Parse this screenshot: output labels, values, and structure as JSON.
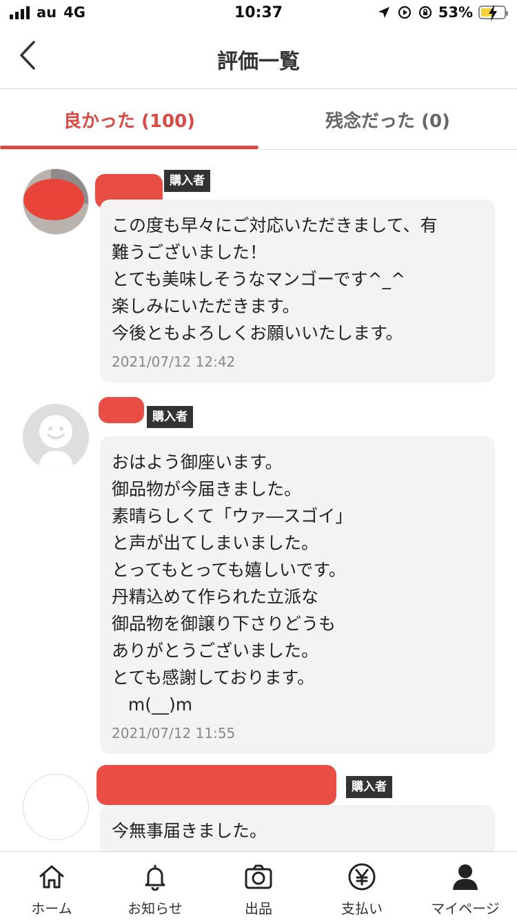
{
  "status_bar": {
    "carrier": "au",
    "network": "4G",
    "time": "10:37",
    "battery": "53%",
    "battery_level": 0.53,
    "battery_color": "#f5d33a"
  },
  "nav": {
    "back_icon": "chevron-left-icon",
    "title": "評価一覧"
  },
  "tabs": [
    {
      "label": "良かった (100)",
      "active": true
    },
    {
      "label": "残念だった (0)",
      "active": false
    }
  ],
  "accent_color": "#d94a45",
  "reviews": [
    {
      "badge": "購入者",
      "lines": [
        "この度も早々にご対応いただきまして、有",
        "難うございました！",
        "とても美味しそうなマンゴーです^_^",
        "楽しみにいただきます。",
        "今後ともよろしくお願いいたします。"
      ],
      "date": "2021/07/12 12:42"
    },
    {
      "badge": "購入者",
      "lines": [
        "おはよう御座います。",
        "御品物が今届きました。",
        "素晴らしくて「ウァ―スゴイ」",
        "と声が出てしまいました。",
        "とってもとっても嬉しいです。",
        "丹精込めて作られた立派な",
        "御品物を御譲り下さりどうも",
        "ありがとうございました。",
        "とても感謝しております。",
        "   m(__)m"
      ],
      "date": "2021/07/12 11:55"
    },
    {
      "badge": "購入者",
      "lines": [
        "今無事届きました。"
      ]
    }
  ],
  "tabbar": [
    {
      "label": "ホーム",
      "icon": "home-icon"
    },
    {
      "label": "お知らせ",
      "icon": "bell-icon"
    },
    {
      "label": "出品",
      "icon": "camera-icon"
    },
    {
      "label": "支払い",
      "icon": "yen-icon"
    },
    {
      "label": "マイページ",
      "icon": "person-icon"
    }
  ]
}
